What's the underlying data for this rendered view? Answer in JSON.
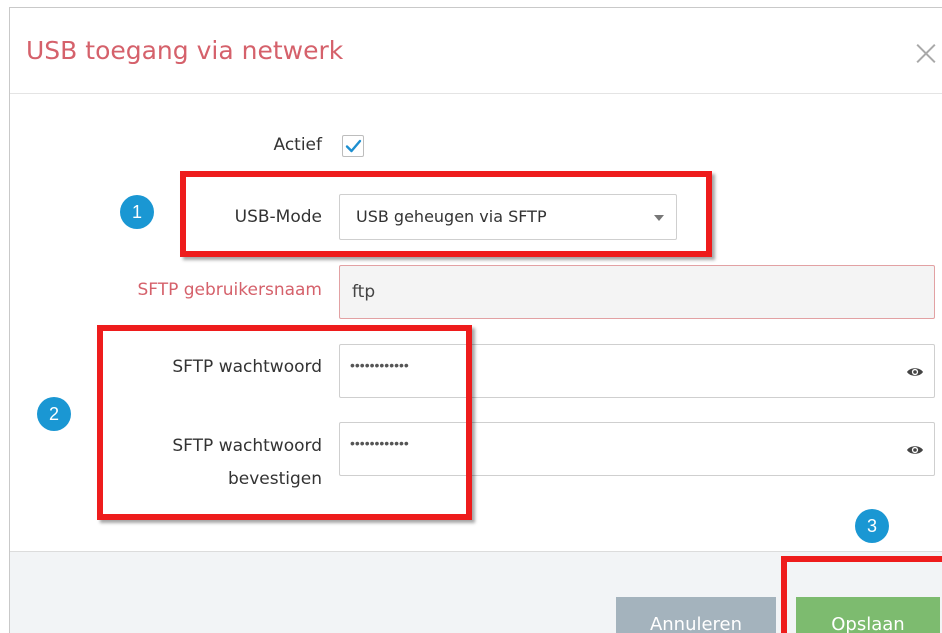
{
  "dialog": {
    "title": "USB toegang via netwerk",
    "close_icon": "close-icon"
  },
  "form": {
    "active_label": "Actief",
    "active_checked": true,
    "usb_mode_label": "USB-Mode",
    "usb_mode_value": "USB geheugen via SFTP",
    "sftp_username_label": "SFTP gebruikersnaam",
    "sftp_username_value": "ftp",
    "sftp_password_label": "SFTP wachtwoord",
    "sftp_password_value": "••••••••••••",
    "sftp_password_confirm_label_line1": "SFTP wachtwoord",
    "sftp_password_confirm_label_line2": "bevestigen",
    "sftp_password_confirm_value": "••••••••••••"
  },
  "footer": {
    "cancel_label": "Annuleren",
    "save_label": "Opslaan"
  },
  "annotations": {
    "badge_1": "1",
    "badge_2": "2",
    "badge_3": "3"
  },
  "colors": {
    "title": "#d5616b",
    "error_label": "#d5616b",
    "badge": "#1a97d3",
    "highlight": "#ee1c1c",
    "save_button": "#7dbb6f",
    "cancel_button": "#a4b3bd"
  }
}
